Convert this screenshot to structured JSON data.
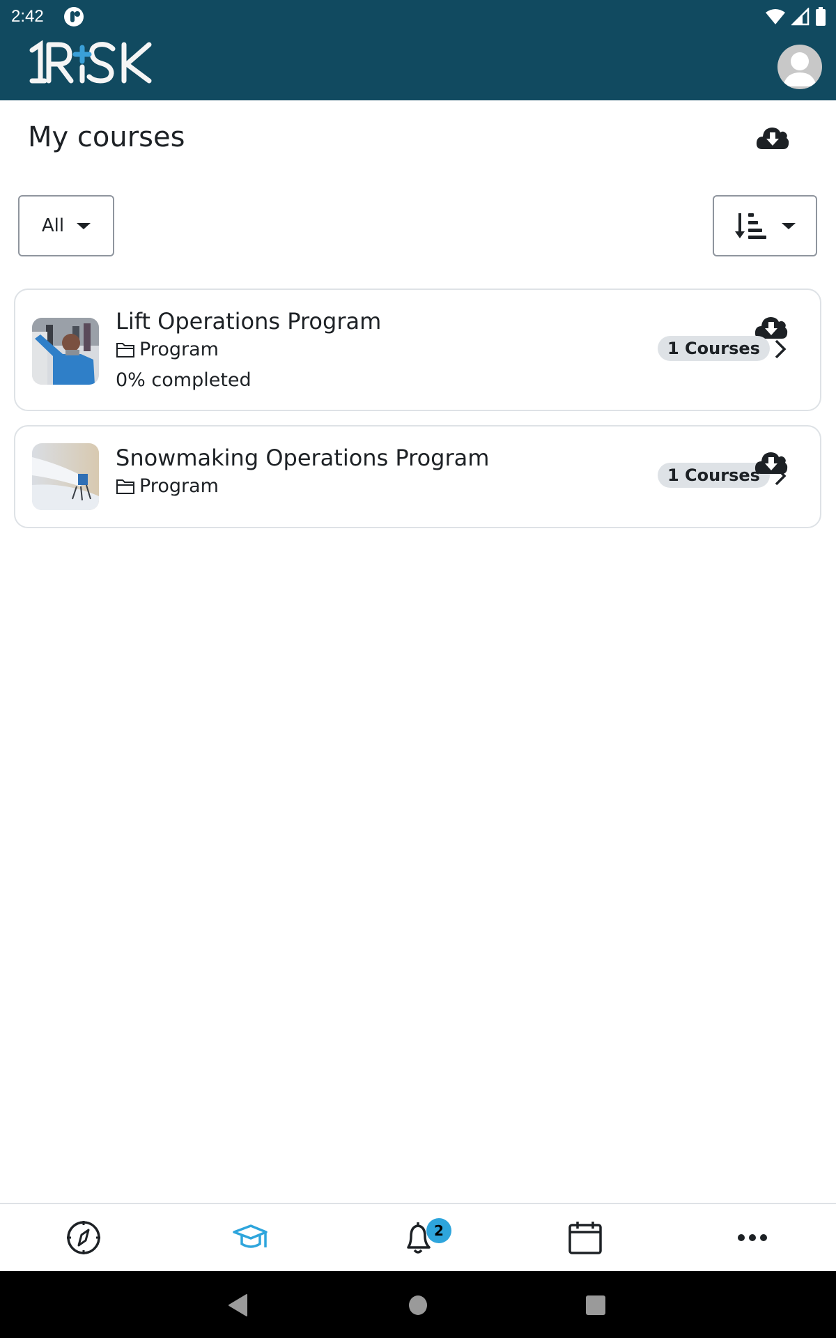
{
  "status_bar": {
    "time": "2:42",
    "icons": [
      "app-notification-icon",
      "wifi-icon",
      "cell-signal-icon",
      "battery-icon"
    ]
  },
  "header": {
    "logo_text": "1RiSK",
    "logo_accent": "#3aa0d8",
    "background": "#114a60",
    "avatar_icon": "user-avatar-icon"
  },
  "page": {
    "title": "My courses",
    "download_all_icon": "cloud-download-icon"
  },
  "filters": {
    "status_filter": {
      "selected": "All",
      "icon": "caret-down-icon"
    },
    "sort": {
      "icon": "sort-amount-down-icon",
      "dropdown_icon": "caret-down-icon"
    }
  },
  "courses": [
    {
      "title": "Lift Operations Program",
      "type": "Program",
      "type_icon": "folder-icon",
      "progress_text": "0% completed",
      "progress": 0,
      "badge": "1 Courses",
      "thumbnail": "lift operator in blue jacket",
      "download_icon": "cloud-download-icon",
      "chevron_icon": "chevron-right-icon"
    },
    {
      "title": "Snowmaking Operations Program",
      "type": "Program",
      "type_icon": "folder-icon",
      "badge": "1 Courses",
      "thumbnail": "snow gun spraying snow",
      "download_icon": "cloud-download-icon",
      "chevron_icon": "chevron-right-icon"
    }
  ],
  "tab_bar": {
    "active_color": "#2ea5dc",
    "tabs": [
      {
        "name": "site-home",
        "icon": "compass-icon",
        "active": false
      },
      {
        "name": "my-courses",
        "icon": "graduation-cap-icon",
        "active": true
      },
      {
        "name": "notifications",
        "icon": "bell-icon",
        "active": false,
        "badge": "2"
      },
      {
        "name": "calendar",
        "icon": "calendar-icon",
        "active": false
      },
      {
        "name": "more",
        "icon": "more-horizontal-icon",
        "active": false
      }
    ]
  },
  "system_nav": {
    "buttons": [
      "back",
      "home",
      "recents"
    ]
  }
}
